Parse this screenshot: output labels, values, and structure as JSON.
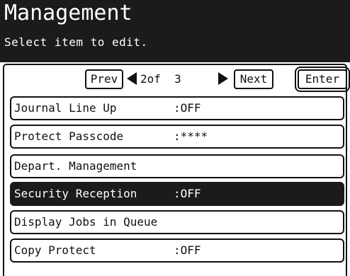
{
  "header": {
    "title": "Management",
    "subtitle": "Select item to edit."
  },
  "nav": {
    "prev_label": "Prev",
    "next_label": "Next",
    "enter_label": "Enter",
    "page_indicator": "2of  3"
  },
  "items": [
    {
      "label": "Journal Line Up",
      "value": ":OFF",
      "selected": false
    },
    {
      "label": "Protect Passcode",
      "value": ":****",
      "selected": false
    },
    {
      "label": "Depart. Management",
      "value": "",
      "selected": false
    },
    {
      "label": "Security Reception",
      "value": ":OFF",
      "selected": true
    },
    {
      "label": "Display Jobs in Queue",
      "value": "",
      "selected": false
    },
    {
      "label": "Copy Protect",
      "value": ":OFF",
      "selected": false
    }
  ],
  "colors": {
    "header_bg": "#1b1b1b",
    "selected_bg": "#1b1b1b",
    "foreground": "#111111",
    "background": "#ffffff"
  }
}
